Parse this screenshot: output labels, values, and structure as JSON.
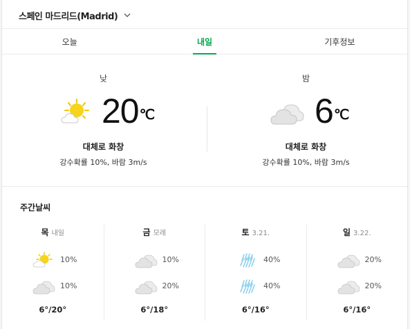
{
  "location": {
    "label": "스페인 마드리드(Madrid)"
  },
  "tabs": [
    {
      "label": "오늘",
      "active": false
    },
    {
      "label": "내일",
      "active": true
    },
    {
      "label": "기후정보",
      "active": false
    }
  ],
  "tomorrow": {
    "day": {
      "period": "낮",
      "temp": "20",
      "unit": "℃",
      "icon": "partly-cloudy-sun-icon",
      "condition": "대체로 화창",
      "detail": "강수확률 10%, 바람 3m/s"
    },
    "night": {
      "period": "밤",
      "temp": "6",
      "unit": "℃",
      "icon": "cloud-icon",
      "condition": "대체로 화창",
      "detail": "강수확률 10%, 바람 3m/s"
    }
  },
  "weekly": {
    "title": "주간날씨",
    "days": [
      {
        "name": "목",
        "date": "내일",
        "am": {
          "icon": "partly-cloudy-sun-icon",
          "pct": "10%"
        },
        "pm": {
          "icon": "cloud-icon",
          "pct": "10%"
        },
        "range": "6°/20°"
      },
      {
        "name": "금",
        "date": "모레",
        "am": {
          "icon": "cloud-icon",
          "pct": "10%"
        },
        "pm": {
          "icon": "cloud-icon",
          "pct": "20%"
        },
        "range": "6°/18°"
      },
      {
        "name": "토",
        "date": "3.21.",
        "am": {
          "icon": "rain-icon",
          "pct": "40%"
        },
        "pm": {
          "icon": "rain-icon",
          "pct": "40%"
        },
        "range": "6°/16°"
      },
      {
        "name": "일",
        "date": "3.22.",
        "am": {
          "icon": "cloud-icon",
          "pct": "20%"
        },
        "pm": {
          "icon": "cloud-icon",
          "pct": "20%"
        },
        "range": "6°/16°"
      }
    ]
  },
  "colors": {
    "accent": "#03a94d",
    "sun": "#f7d31c",
    "cloud": "#e3e3e3",
    "cloud_stroke": "#c9c9c9",
    "rain": "#8ed0ec"
  }
}
